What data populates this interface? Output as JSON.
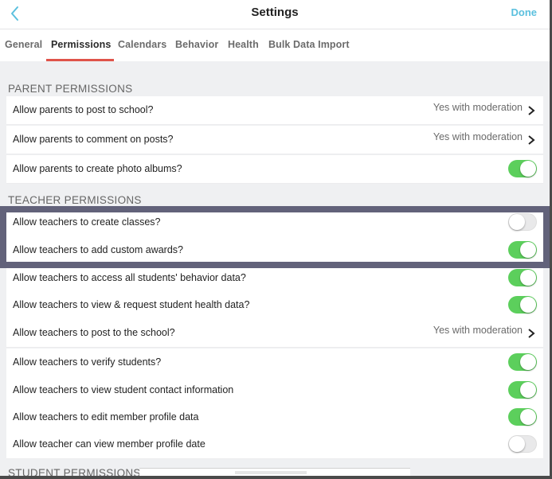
{
  "navbar": {
    "title": "Settings",
    "back_icon": "chevron-left-icon",
    "done_label": "Done"
  },
  "tabs": [
    {
      "label": "General",
      "active": false
    },
    {
      "label": "Permissions",
      "active": true
    },
    {
      "label": "Calendars",
      "active": false
    },
    {
      "label": "Behavior",
      "active": false
    },
    {
      "label": "Health",
      "active": false
    },
    {
      "label": "Bulk Data Import",
      "active": false
    }
  ],
  "colors": {
    "accent": "#5bc0de",
    "tab_underline": "#e0534a",
    "toggle_on": "#5ccf5c",
    "highlight_border": "#62627a"
  },
  "sections": {
    "parent": {
      "title": "PARENT PERMISSIONS",
      "rows": [
        {
          "label": "Allow parents to post to school?",
          "type": "select",
          "value": "Yes with moderation"
        },
        {
          "label": "Allow parents to comment on posts?",
          "type": "select",
          "value": "Yes with moderation"
        },
        {
          "label": "Allow parents to create photo albums?",
          "type": "toggle",
          "on": true
        }
      ]
    },
    "teacher": {
      "title": "TEACHER PERMISSIONS",
      "rows": [
        {
          "label": "Allow teachers to create classes?",
          "type": "toggle",
          "on": false
        },
        {
          "label": "Allow teachers to add custom awards?",
          "type": "toggle",
          "on": true
        },
        {
          "label": "Allow teachers to access all students' behavior data?",
          "type": "toggle",
          "on": true
        },
        {
          "label": "Allow teachers to view & request student health data?",
          "type": "toggle",
          "on": true
        },
        {
          "label": "Allow teachers to post to the school?",
          "type": "select",
          "value": "Yes with moderation"
        },
        {
          "label": "Allow teachers to verify students?",
          "type": "toggle",
          "on": true
        },
        {
          "label": "Allow teachers to view student contact information",
          "type": "toggle",
          "on": true
        },
        {
          "label": "Allow teachers to edit member profile data",
          "type": "toggle",
          "on": true
        },
        {
          "label": "Allow teacher can view member profile date",
          "type": "toggle",
          "on": false
        }
      ]
    },
    "student": {
      "title": "STUDENT PERMISSIONS"
    }
  }
}
